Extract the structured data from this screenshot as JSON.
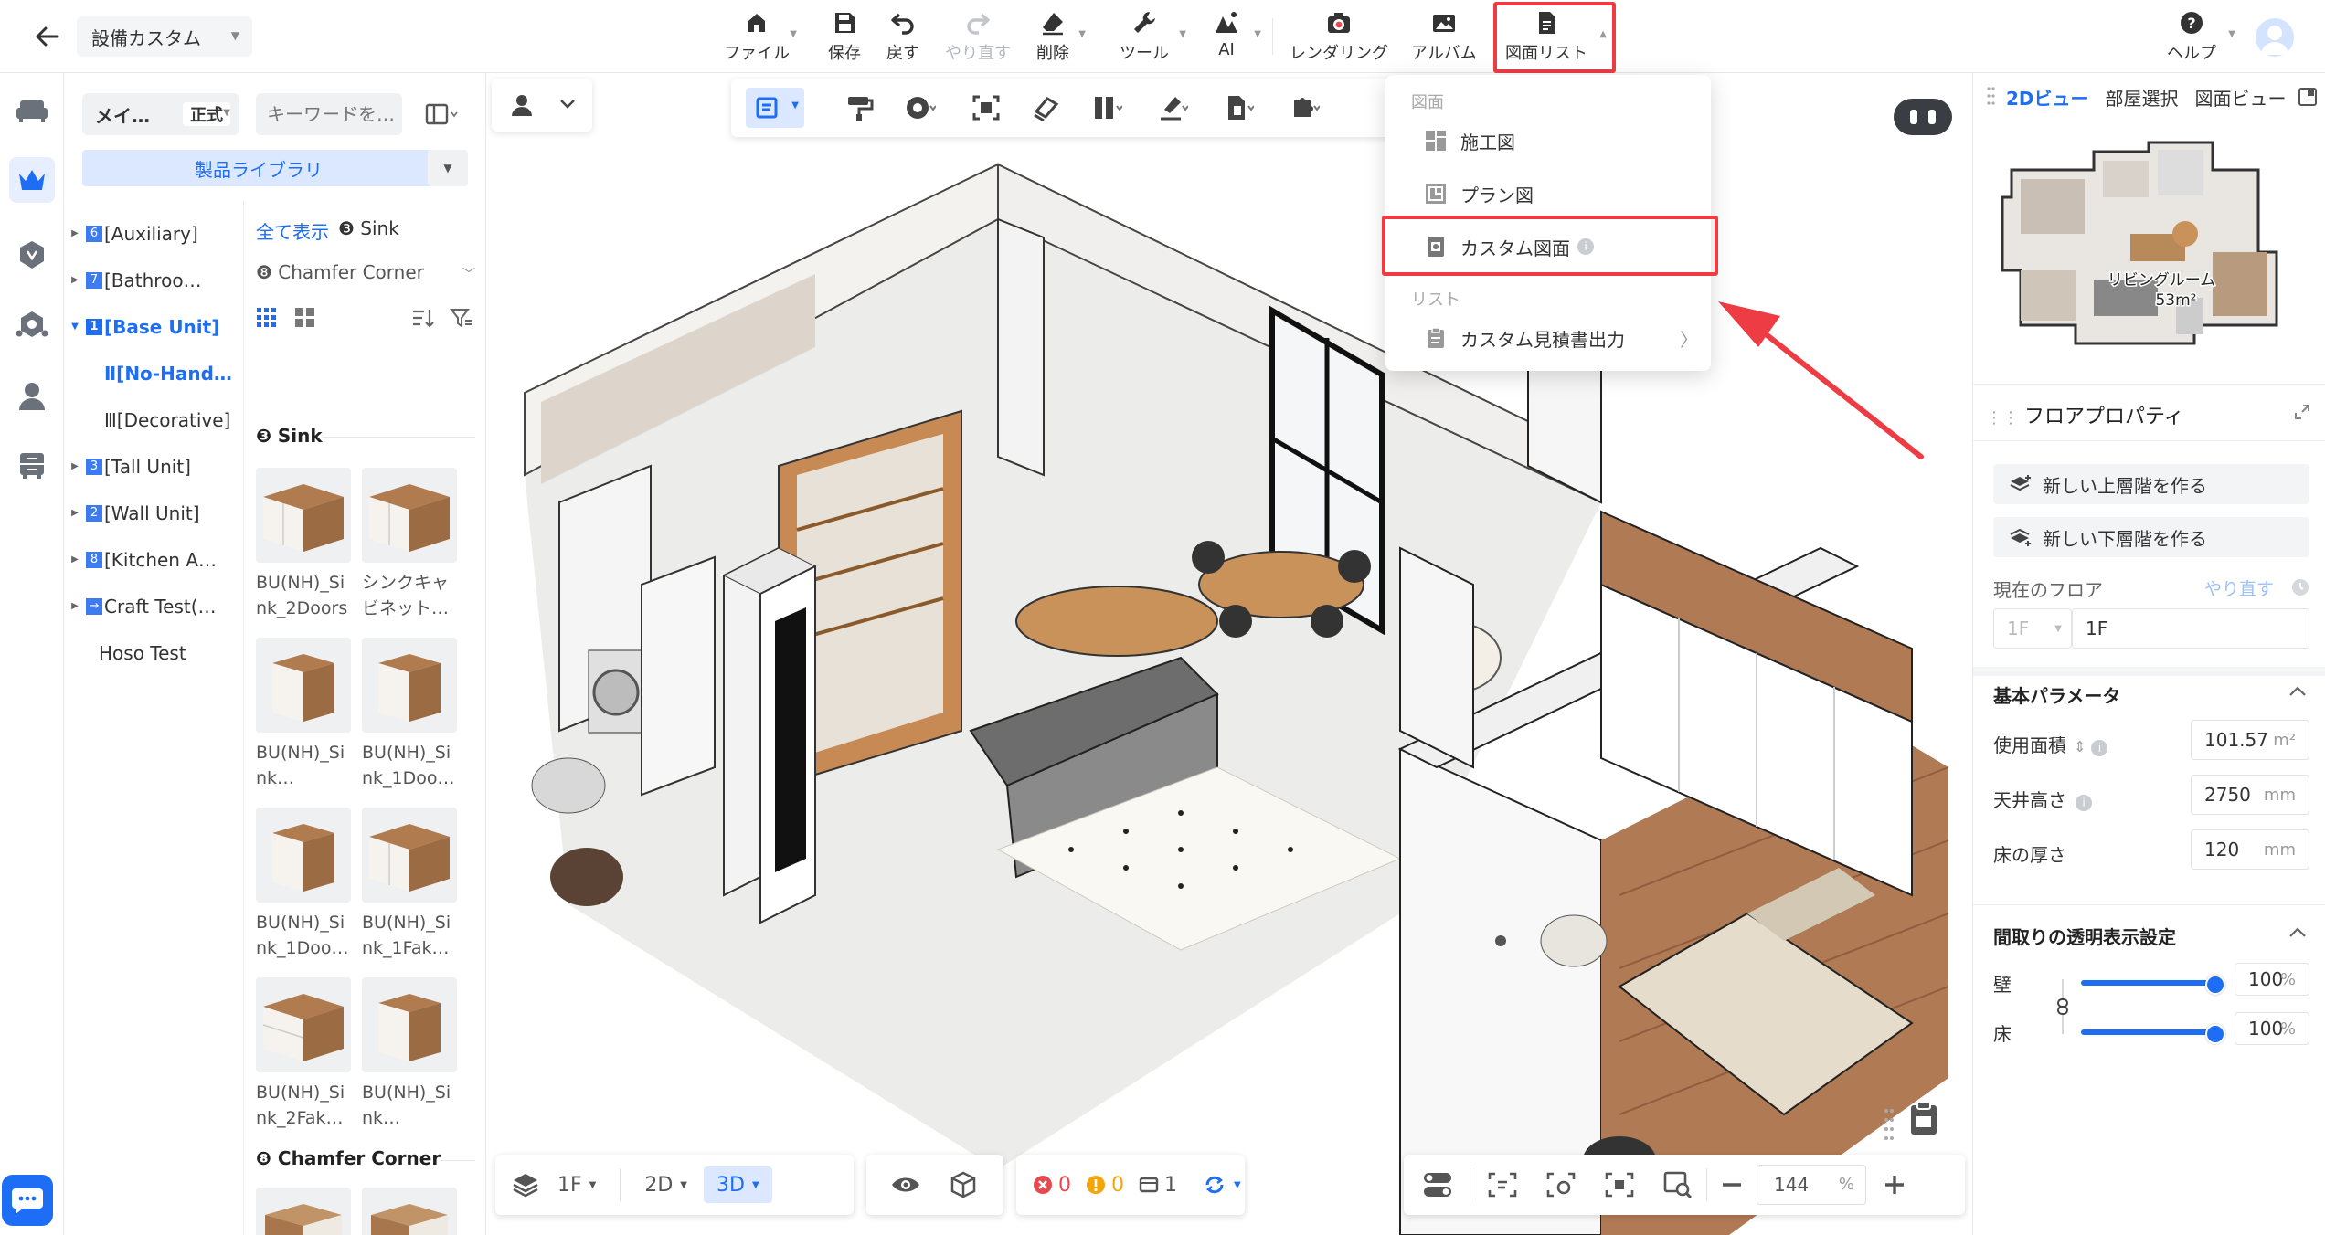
{
  "topbar": {
    "project_name": "設備カスタム",
    "items": [
      {
        "label": "ファイル",
        "icon": "home-icon"
      },
      {
        "label": "保存",
        "icon": "save-icon"
      },
      {
        "label": "戻す",
        "icon": "undo-icon"
      },
      {
        "label": "やり直す",
        "icon": "redo-icon",
        "disabled": true
      },
      {
        "label": "削除",
        "icon": "eraser-icon"
      },
      {
        "label": "ツール",
        "icon": "wrench-icon"
      },
      {
        "label": "AI",
        "icon": "ai-icon"
      },
      {
        "label": "レンダリング",
        "icon": "camera-icon"
      },
      {
        "label": "アルバム",
        "icon": "album-icon"
      },
      {
        "label": "図面リスト",
        "icon": "document-icon",
        "highlighted": true
      }
    ],
    "help_label": "ヘルプ",
    "highlight_color": "#ee3c44"
  },
  "left_panel": {
    "mode": {
      "label": "メイ…",
      "badge": "正式"
    },
    "search_placeholder": "キーワードを…",
    "library_label": "製品ライブラリ",
    "tree": [
      {
        "num": "6",
        "label": "[Auxiliary]",
        "expandable": true
      },
      {
        "num": "7",
        "label": "[Bathroo…",
        "expandable": true
      },
      {
        "num": "1",
        "label": "[Base Unit]",
        "expandable": true,
        "expanded": true,
        "active": true
      },
      {
        "label": "Ⅱ[No-Hand…",
        "child": true,
        "active": true
      },
      {
        "label": "Ⅲ[Decorative]",
        "child": true
      },
      {
        "num": "3",
        "label": "[Tall Unit]",
        "expandable": true
      },
      {
        "num": "2",
        "label": "[Wall Unit]",
        "expandable": true
      },
      {
        "num": "8",
        "label": "[Kitchen A…",
        "expandable": true
      },
      {
        "num": "→",
        "label": "Craft Test(…",
        "expandable": true
      },
      {
        "label": "Hoso Test"
      }
    ],
    "filter": {
      "show_all": "全て表示",
      "current": "❸ Sink"
    },
    "chamfer_selector": "❽ Chamfer Corner",
    "group_sink": "❸ Sink",
    "group_chamfer": "❽ Chamfer Corner",
    "products": [
      "BU(NH)_Sink_2Doors",
      "シンクキャビネット…",
      "BU(NH)_Sink…",
      "BU(NH)_Sink_1Doo…",
      "BU(NH)_Sink_1Doo…",
      "BU(NH)_Sink_1Fak…",
      "BU(NH)_Sink_2Fak…",
      "BU(NH)_Sink…"
    ]
  },
  "dropdown": {
    "section_drawing": "図面",
    "section_list": "リスト",
    "items": [
      "施工図",
      "プラン図",
      "カスタム図面"
    ],
    "info_glyph": "i",
    "list_item": "カスタム見積書出力"
  },
  "viewport": {
    "floor": "1F",
    "view_2d": "2D",
    "view_3d": "3D",
    "errors": "0",
    "warnings": "0",
    "groups": "1",
    "zoom": "144",
    "zoom_unit": "%"
  },
  "right_panel": {
    "tabs": [
      "2Dビュー",
      "部屋選択",
      "図面ビュー"
    ],
    "room_label": "リビングルーム",
    "room_area": "53m²",
    "floor_props_title": "フロアプロパティ",
    "btn_new_upper": "新しい上層階を作る",
    "btn_new_lower": "新しい下層階を作る",
    "current_floor_label": "現在のフロア",
    "redo_label": "やり直す",
    "floor_select": "1F",
    "floor_name": "1F",
    "basic_params_title": "基本パラメータ",
    "area_label": "使用面積",
    "area_value": "101.57",
    "area_unit": "m²",
    "ceiling_label": "天井高さ",
    "ceiling_value": "2750",
    "ceiling_unit": "mm",
    "floor_thick_label": "床の厚さ",
    "floor_thick_value": "120",
    "floor_thick_unit": "mm",
    "transparency_title": "間取りの透明表示設定",
    "wall_label": "壁",
    "wall_value": "100",
    "floor_label": "床",
    "floor_value": "100",
    "percent": "%"
  }
}
